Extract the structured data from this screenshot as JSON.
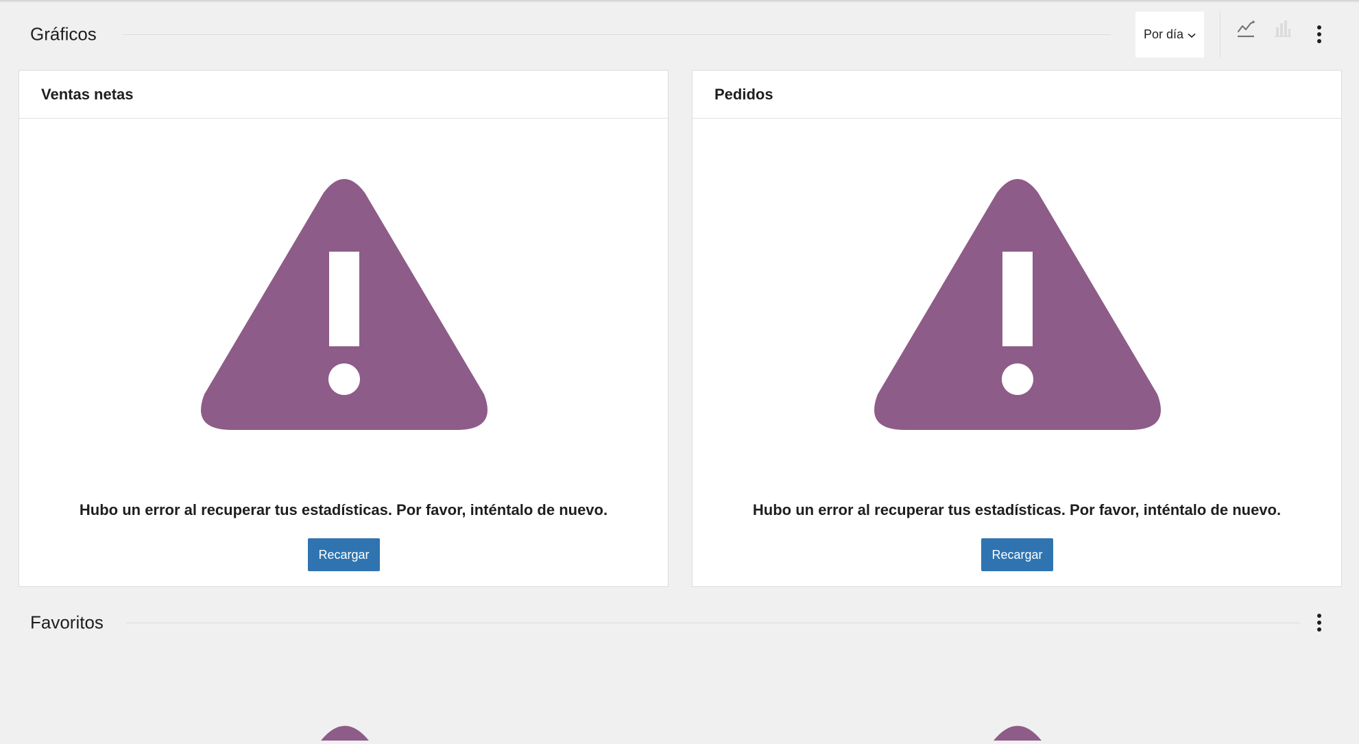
{
  "charts_section": {
    "title": "Gráficos",
    "period_select": {
      "value": "Por día"
    },
    "icons": [
      "line-chart-icon",
      "bar-chart-icon",
      "more-vertical-icon"
    ]
  },
  "cards": [
    {
      "title": "Ventas netas",
      "error_message": "Hubo un error al recuperar tus estadísticas. Por favor, inténtalo de nuevo.",
      "reload_label": "Recargar"
    },
    {
      "title": "Pedidos",
      "error_message": "Hubo un error al recuperar tus estadísticas. Por favor, inténtalo de nuevo.",
      "reload_label": "Recargar"
    }
  ],
  "favorites_section": {
    "title": "Favoritos"
  },
  "colors": {
    "accent_purple": "#8e5c88",
    "button_blue": "#2f74b0",
    "background": "#f0f0f1",
    "card_background": "#ffffff"
  }
}
